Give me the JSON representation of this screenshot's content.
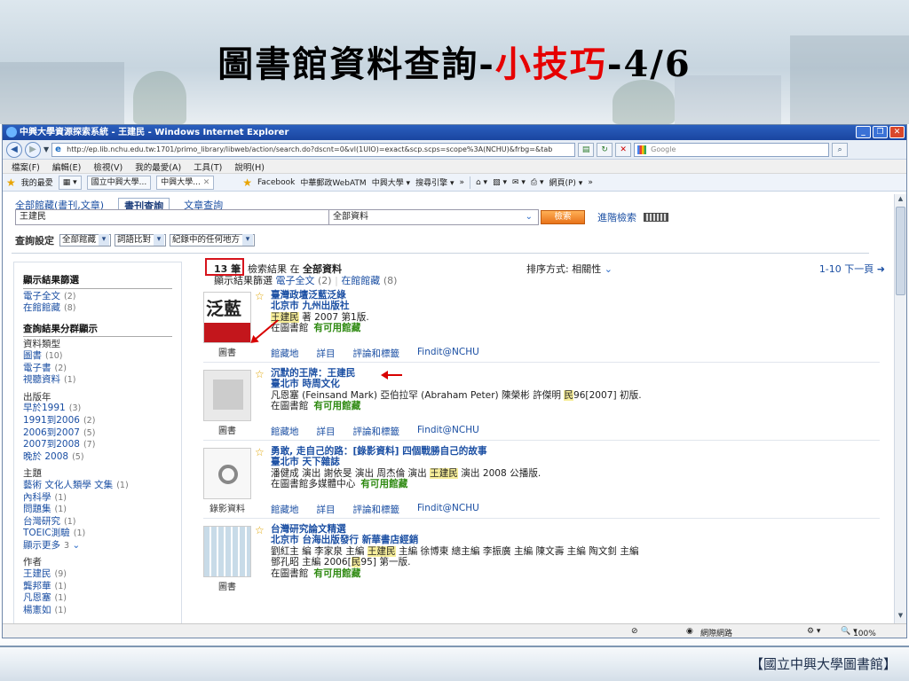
{
  "slide": {
    "title_main": "圖書館資料查詢-",
    "title_highlight": "小技巧",
    "title_suffix": "-4/6",
    "footer_credit": "【國立中興大學圖書館】"
  },
  "browser": {
    "window_title": "中興大學資源探索系統 - 王建民 - Windows Internet Explorer",
    "url": "http://ep.lib.nchu.edu.tw:1701/primo_library/libweb/action/search.do?dscnt=0&vl(1UIO)=exact&scp.scps=scope%3A(NCHU)&frbg=&tab",
    "search_placeholder": "Google",
    "menu": [
      "檔案(F)",
      "編輯(E)",
      "檢視(V)",
      "我的最愛(A)",
      "工具(T)",
      "說明(H)"
    ],
    "favorites_label": "我的最愛",
    "tabs": [
      "國立中興大學...",
      "中興大學..."
    ],
    "fav_links": [
      "Facebook",
      "中華郵政WebATM",
      "中興大學 ▾",
      "搜尋引擎 ▾"
    ],
    "fav_tools": [
      "網頁(P) ▾"
    ],
    "status_zone": "網際網路",
    "status_zoom": "100%"
  },
  "library": {
    "search_tabs": [
      "全部館藏(書刊,文章)",
      "書刊查詢",
      "文章查詢"
    ],
    "query": "王建民",
    "scope": "全部資料",
    "search_button": "檢索",
    "advanced": "進階檢索",
    "settings_label": "查詢設定",
    "settings": [
      "全部館藏",
      "詞語比對",
      "紀錄中的任何地方"
    ]
  },
  "facets": {
    "title1": "顯示結果篩選",
    "filter": [
      {
        "label": "電子全文",
        "count": "(2)"
      },
      {
        "label": "在館館藏",
        "count": "(8)"
      }
    ],
    "title2": "查詢結果分群顯示",
    "type_label": "資料類型",
    "types": [
      {
        "label": "圖書",
        "count": "(10)"
      },
      {
        "label": "電子書",
        "count": "(2)"
      },
      {
        "label": "視聽資料",
        "count": "(1)"
      }
    ],
    "year_label": "出版年",
    "years": [
      {
        "label": "早於1991",
        "count": "(3)"
      },
      {
        "label": "1991到2006",
        "count": "(2)"
      },
      {
        "label": "2006到2007",
        "count": "(5)"
      },
      {
        "label": "2007到2008",
        "count": "(7)"
      },
      {
        "label": "晚於 2008",
        "count": "(5)"
      }
    ],
    "subject_label": "主題",
    "subjects": [
      {
        "label": "藝術 文化人類學 文集",
        "count": "(1)"
      },
      {
        "label": "內科學",
        "count": "(1)"
      },
      {
        "label": "問題集",
        "count": "(1)"
      },
      {
        "label": "台灣研究",
        "count": "(1)"
      },
      {
        "label": "TOEIC測驗",
        "count": "(1)"
      }
    ],
    "more": "顯示更多",
    "more_count": "3",
    "author_label": "作者",
    "authors": [
      {
        "label": "王建民",
        "count": "(9)"
      },
      {
        "label": "龔邦華",
        "count": "(1)"
      },
      {
        "label": "凡恩塞",
        "count": "(1)"
      },
      {
        "label": "楊憲如",
        "count": "(1)"
      }
    ]
  },
  "results": {
    "count": "13 筆",
    "label_a": "檢索結果 在 ",
    "label_b": "全部資料",
    "sort_label": "排序方式: ",
    "sort_value": "相關性",
    "pager": "1-10 下一頁 ➜",
    "filter_label": "顯示結果篩選",
    "filter_a": "電子全文",
    "filter_a_count": "(2)",
    "filter_b": "在館館藏",
    "filter_b_count": "(8)",
    "actions": [
      "館藏地",
      "詳目",
      "評論和標籤",
      "Findit@NCHU"
    ],
    "items": [
      {
        "title": "臺灣政壇泛藍泛綠",
        "publisher": "北京市 九州出版社",
        "author_hl": "王建民",
        "author_rest": " 著 2007 第1版.",
        "location": "在圖書館",
        "availability": "有可用館藏",
        "type": "圖書",
        "cover_text": "泛藍"
      },
      {
        "title": "沉默的王牌：王建民",
        "publisher": "臺北市 時周文化",
        "author_line_a": "凡恩塞 (Feinsand Mark) 亞伯拉罕 (Abraham Peter) 陳榮彬 許傑明 ",
        "author_hl": "民",
        "author_line_b": "96[2007] 初版.",
        "location": "在圖書館",
        "availability": "有可用館藏",
        "type": "圖書"
      },
      {
        "title": "勇敢, 走自己的路：[錄影資料] 四個戰勝自己的故事",
        "publisher": "臺北市 天下雜誌",
        "author_line_a": "潘健成 演出 謝依旻 演出 周杰倫 演出 ",
        "author_hl": "王建民",
        "author_line_b": " 演出 2008 公播版.",
        "location": "在圖書館多媒體中心",
        "availability": "有可用館藏",
        "type": "錄影資料"
      },
      {
        "title": "台灣研究論文精選",
        "publisher": "北京市 台海出版發行 新華書店經銷",
        "author_line_a": "劉紅主 編 李家泉 主編 ",
        "author_hl": "王建民",
        "author_line_b": " 主編 徐博東 總主編 李振廣 主編 陳文壽 主編 陶文釗 主編",
        "author_line_c_a": "鄧孔昭 主編 2006[",
        "author_line_c_hl": "民",
        "author_line_c_b": "95] 第一版.",
        "location": "在圖書館",
        "availability": "有可用館藏",
        "type": "圖書"
      }
    ]
  }
}
